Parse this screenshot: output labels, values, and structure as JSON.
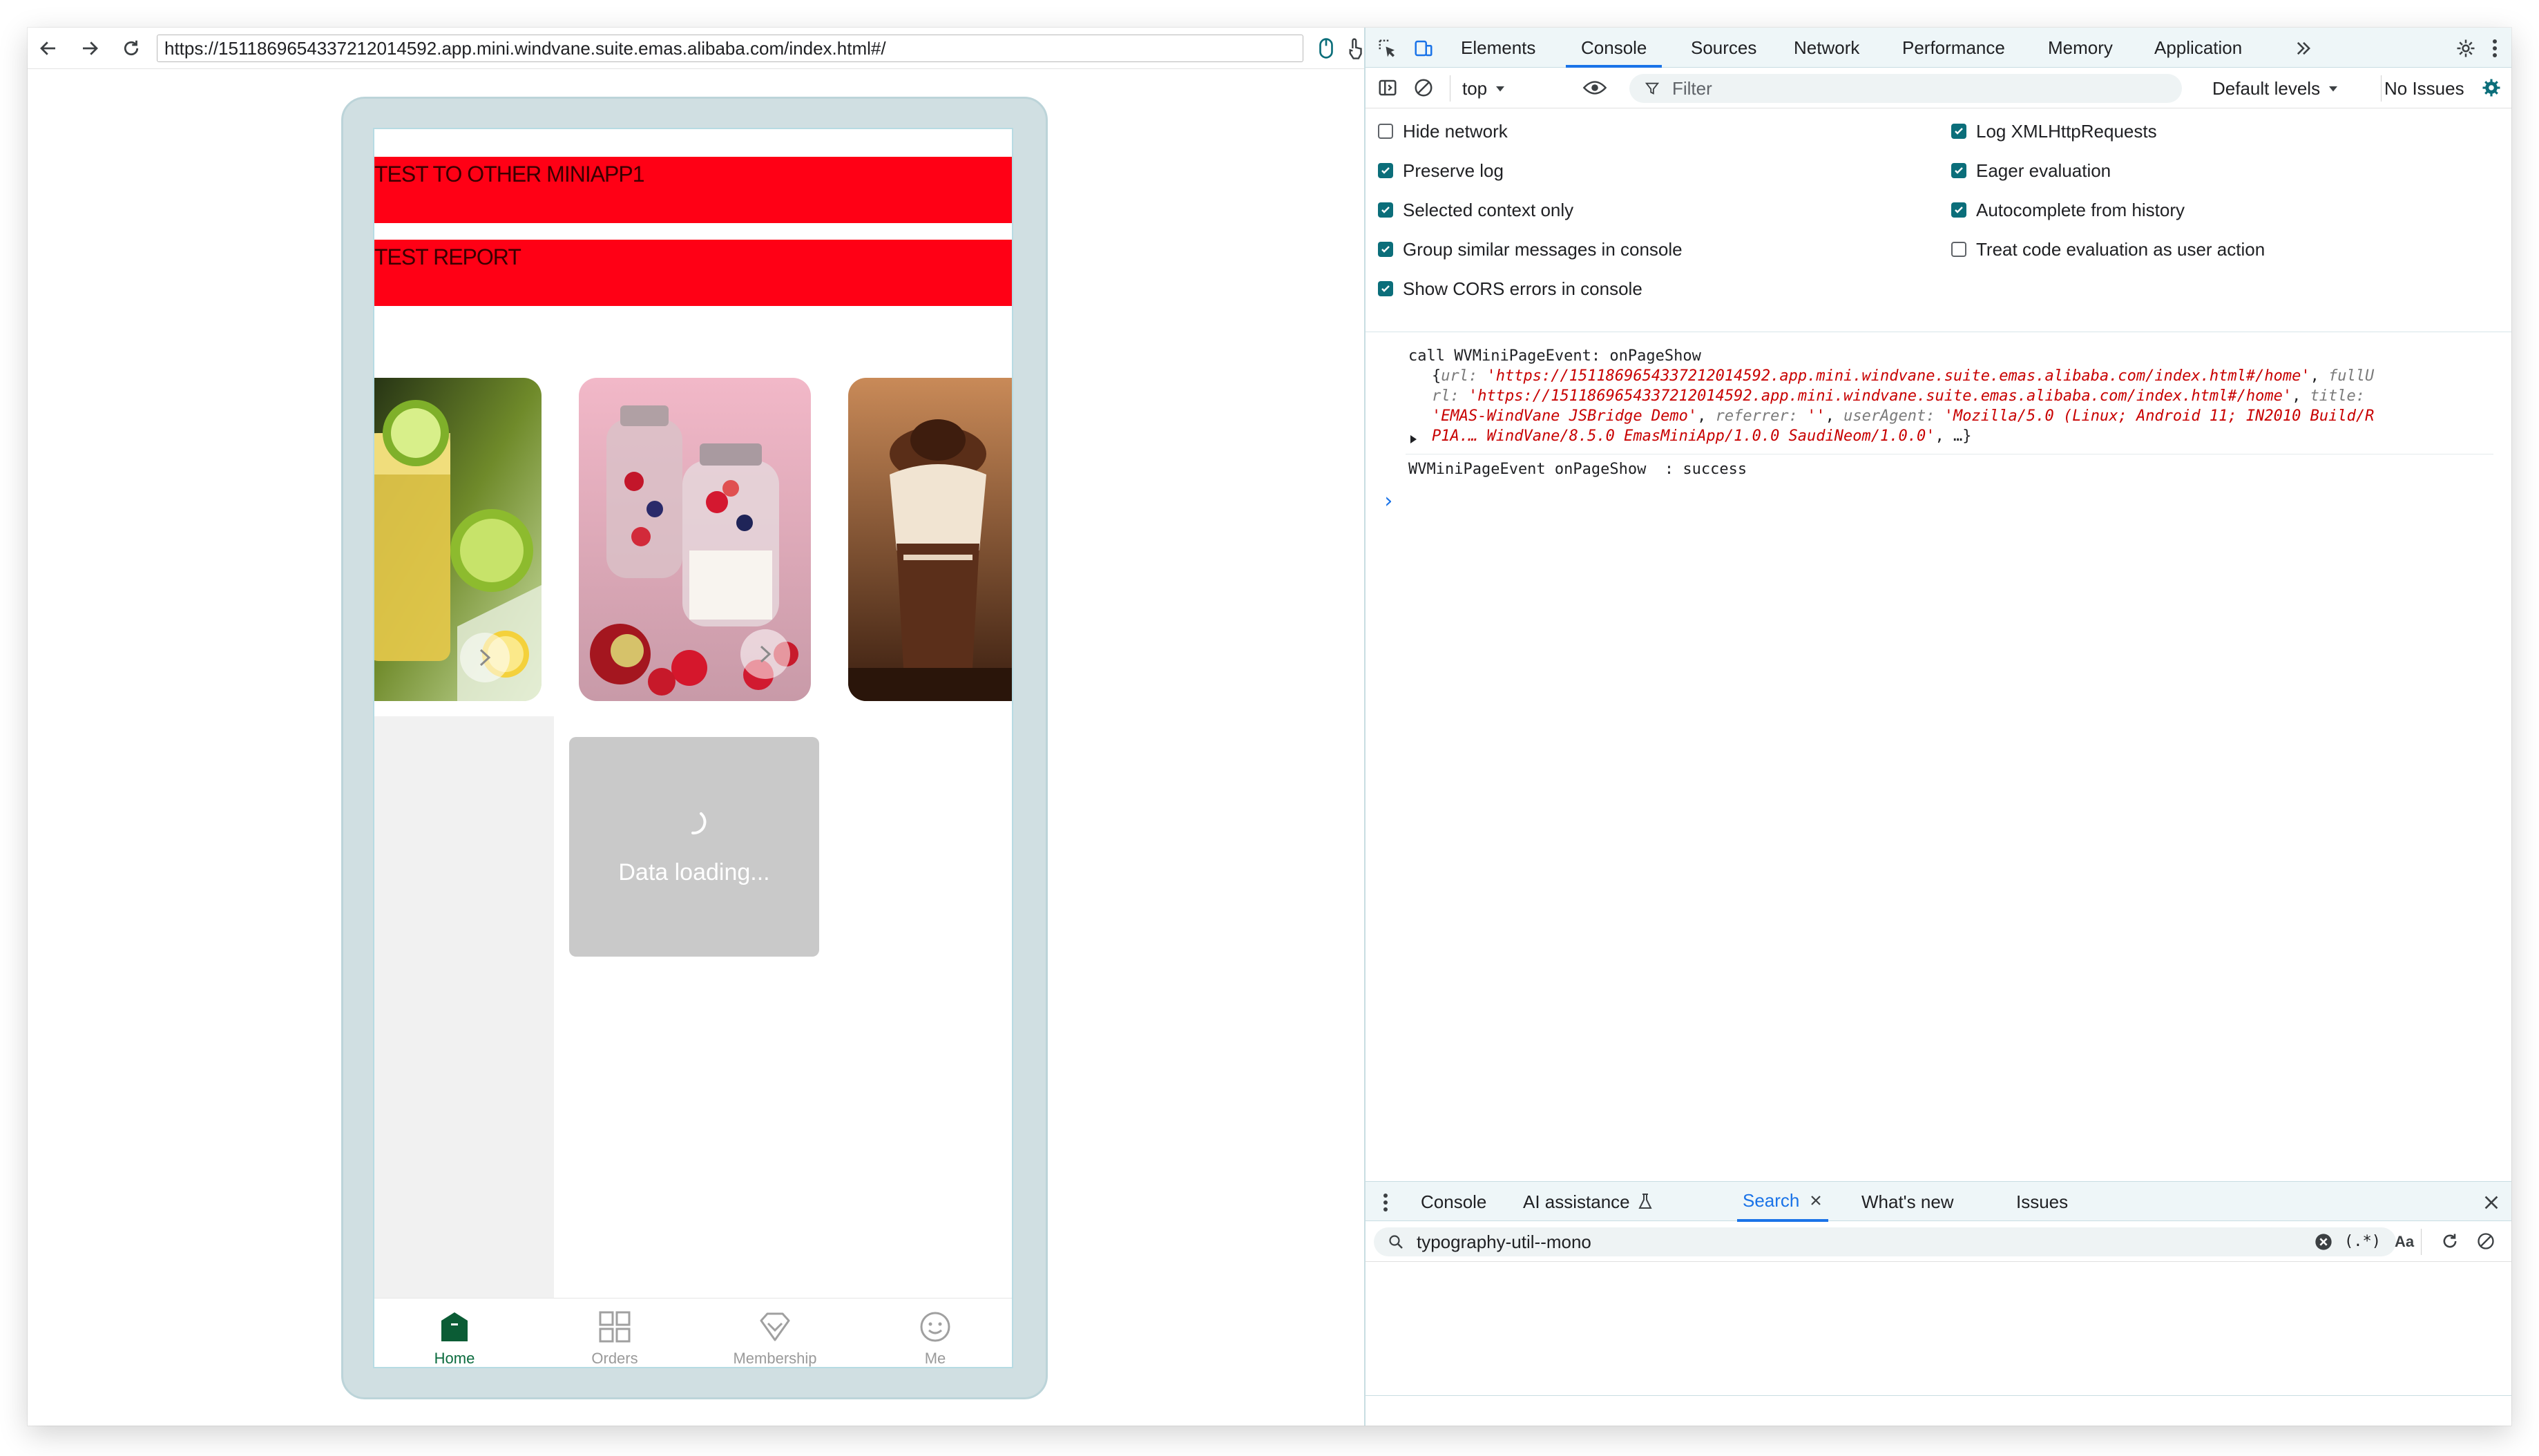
{
  "browser": {
    "url": "https://1511869654337212014592.app.mini.windvane.suite.emas.alibaba.com/index.html#/"
  },
  "app": {
    "btn_other_miniapp": "TEST TO OTHER MINIAPP1",
    "btn_report": "TEST REPORT",
    "loading_text": "Data loading...",
    "tabs": [
      {
        "label": "Home",
        "icon": "home-icon",
        "active": true
      },
      {
        "label": "Orders",
        "icon": "grid-icon",
        "active": false
      },
      {
        "label": "Membership",
        "icon": "diamond-icon",
        "active": false
      },
      {
        "label": "Me",
        "icon": "smiley-icon",
        "active": false
      }
    ],
    "colors": {
      "accent": "#0b6b3e",
      "button_red": "#ff0015"
    }
  },
  "devtools": {
    "tabs": [
      "Elements",
      "Console",
      "Sources",
      "Network",
      "Performance",
      "Memory",
      "Application"
    ],
    "selected_tab": "Console",
    "context": "top",
    "filter_placeholder": "Filter",
    "levels": "Default levels",
    "issues": "No Issues",
    "settings_left": [
      {
        "label": "Hide network",
        "checked": false
      },
      {
        "label": "Preserve log",
        "checked": true
      },
      {
        "label": "Selected context only",
        "checked": true
      },
      {
        "label": "Group similar messages in console",
        "checked": true
      },
      {
        "label": "Show CORS errors in console",
        "checked": true
      }
    ],
    "settings_right": [
      {
        "label": "Log XMLHttpRequests",
        "checked": true
      },
      {
        "label": "Eager evaluation",
        "checked": true
      },
      {
        "label": "Autocomplete from history",
        "checked": true
      },
      {
        "label": "Treat code evaluation as user action",
        "checked": false
      }
    ],
    "console": {
      "msg1_head": "call WVMiniPageEvent: onPageShow",
      "obj": {
        "k_url": "url",
        "v_url": "'https://1511869654337212014592.app.mini.windvane.suite.emas.alibaba.com/index.html#/home'",
        "k_fullurl_a": "fullU",
        "k_fullurl_b": "rl",
        "v_fullurl": "'https://1511869654337212014592.app.mini.windvane.suite.emas.alibaba.com/index.html#/home'",
        "k_title": "title",
        "v_title": "'EMAS-WindVane JSBridge Demo'",
        "k_referrer": "referrer",
        "v_referrer": "''",
        "k_ua": "userAgent",
        "v_ua_a": "'Mozilla/5.0 (Linux; Android 11; IN2010 Build/R",
        "v_ua_b": "P1A.… WindVane/8.5.0 EmasMiniApp/1.0.0 SaudiNeom/1.0.0'",
        "tail": ", …}"
      },
      "msg2": "WVMiniPageEvent onPageShow  : success",
      "prompt": "›"
    },
    "drawer": {
      "tabs": [
        "Console",
        "AI assistance",
        "Search",
        "What's new",
        "Issues"
      ],
      "selected": "Search",
      "search_value": "typography-util--mono",
      "regex_label": "(.*)",
      "case_label": "Aa"
    }
  }
}
